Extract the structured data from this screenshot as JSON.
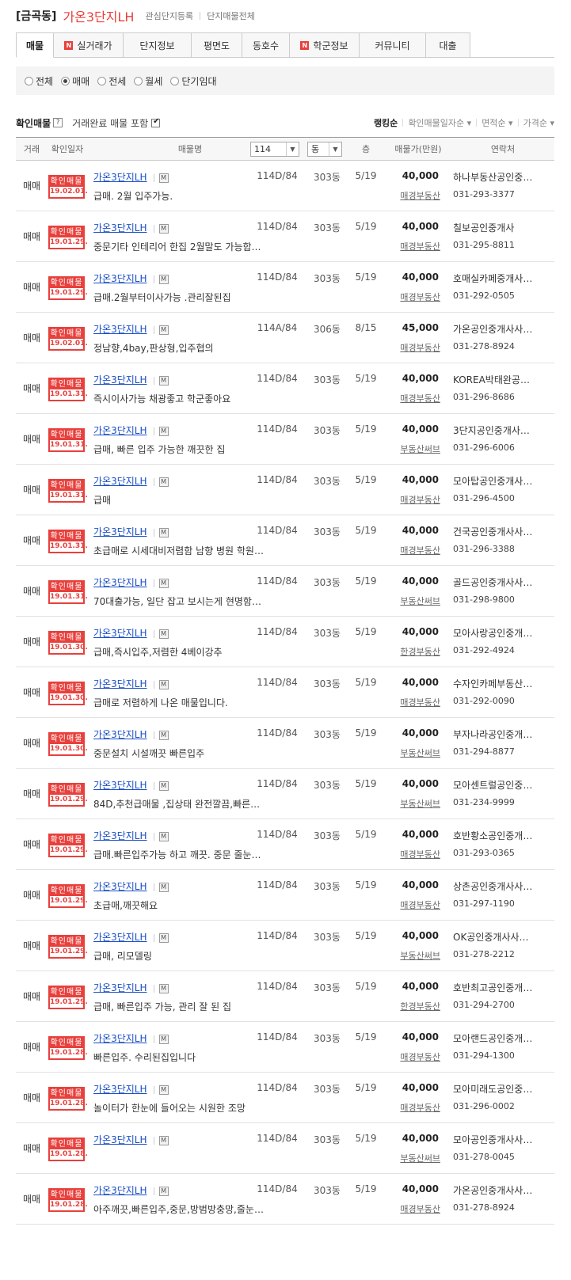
{
  "header": {
    "region": "[금곡동]",
    "complex_name": "가온3단지LH",
    "link_watch": "관심단지등록",
    "link_all": "단지매물전체"
  },
  "tabs": [
    {
      "label": "매물",
      "badge": "",
      "active": true
    },
    {
      "label": "실거래가",
      "badge": "N",
      "active": false
    },
    {
      "label": "단지정보",
      "badge": "",
      "active": false
    },
    {
      "label": "평면도",
      "badge": "",
      "active": false
    },
    {
      "label": "동호수",
      "badge": "",
      "active": false
    },
    {
      "label": "학군정보",
      "badge": "N",
      "active": false
    },
    {
      "label": "커뮤니티",
      "badge": "",
      "active": false
    },
    {
      "label": "대출",
      "badge": "",
      "active": false
    }
  ],
  "trade_types": [
    {
      "label": "전체",
      "selected": false
    },
    {
      "label": "매매",
      "selected": true
    },
    {
      "label": "전세",
      "selected": false
    },
    {
      "label": "월세",
      "selected": false
    },
    {
      "label": "단기임대",
      "selected": false
    }
  ],
  "listing_header": {
    "confirmed_label": "확인매물",
    "help_icon": "?",
    "include_completed": "거래완료 매물 포함",
    "include_completed_checked": true,
    "sorts": [
      "랭킹순",
      "확인매물일자순",
      "면적순",
      "가격순"
    ],
    "active_sort": "랭킹순"
  },
  "columns": {
    "type": "거래",
    "confirm_date": "확인일자",
    "name": "매물명",
    "area_select": "114",
    "dong_select": "동",
    "floor": "층",
    "price": "매물가(만원)",
    "contact": "연락처"
  },
  "stamp_label": "확인매물",
  "listings": [
    {
      "type": "매매",
      "date": "19.02.01.",
      "name": "가온3단지LH",
      "desc": "급매. 2월 입주가능.",
      "area": "114D/84",
      "dong": "303동",
      "floor": "5/19",
      "price": "40,000",
      "agency": "매경부동산",
      "contact": "하나부동산공인중…",
      "phone": "031-293-3377"
    },
    {
      "type": "매매",
      "date": "19.01.29.",
      "name": "가온3단지LH",
      "desc": "중문기타 인테리어 한집 2월말도 가능합…",
      "area": "114D/84",
      "dong": "303동",
      "floor": "5/19",
      "price": "40,000",
      "agency": "매경부동산",
      "contact": "칠보공인중개사",
      "phone": "031-295-8811"
    },
    {
      "type": "매매",
      "date": "19.01.29.",
      "name": "가온3단지LH",
      "desc": "급매.2월부터이사가능 .관리잘된집",
      "area": "114D/84",
      "dong": "303동",
      "floor": "5/19",
      "price": "40,000",
      "agency": "매경부동산",
      "contact": "호매실카페중개사…",
      "phone": "031-292-0505"
    },
    {
      "type": "매매",
      "date": "19.02.01.",
      "name": "가온3단지LH",
      "desc": "정남향,4bay,판상형,입주협의",
      "area": "114A/84",
      "dong": "306동",
      "floor": "8/15",
      "price": "45,000",
      "agency": "매경부동산",
      "contact": "가온공인중개사사…",
      "phone": "031-278-8924"
    },
    {
      "type": "매매",
      "date": "19.01.31.",
      "name": "가온3단지LH",
      "desc": "즉시이사가능 채광좋고 학군좋아요",
      "area": "114D/84",
      "dong": "303동",
      "floor": "5/19",
      "price": "40,000",
      "agency": "매경부동산",
      "contact": "KOREA박태완공…",
      "phone": "031-296-8686"
    },
    {
      "type": "매매",
      "date": "19.01.31.",
      "name": "가온3단지LH",
      "desc": "급매, 빠른 입주 가능한 깨끗한 집",
      "area": "114D/84",
      "dong": "303동",
      "floor": "5/19",
      "price": "40,000",
      "agency": "부동산써브",
      "contact": "3단지공인중개사…",
      "phone": "031-296-6006"
    },
    {
      "type": "매매",
      "date": "19.01.31.",
      "name": "가온3단지LH",
      "desc": "급매",
      "area": "114D/84",
      "dong": "303동",
      "floor": "5/19",
      "price": "40,000",
      "agency": "매경부동산",
      "contact": "모아탑공인중개사…",
      "phone": "031-296-4500"
    },
    {
      "type": "매매",
      "date": "19.01.31.",
      "name": "가온3단지LH",
      "desc": "초급매로 시세대비저렴함 남향 병원 학원…",
      "area": "114D/84",
      "dong": "303동",
      "floor": "5/19",
      "price": "40,000",
      "agency": "매경부동산",
      "contact": "건국공인중개사사…",
      "phone": "031-296-3388"
    },
    {
      "type": "매매",
      "date": "19.01.31.",
      "name": "가온3단지LH",
      "desc": "70대출가능, 일단 잡고 보시는게 현명함…",
      "area": "114D/84",
      "dong": "303동",
      "floor": "5/19",
      "price": "40,000",
      "agency": "부동산써브",
      "contact": "골드공인중개사사…",
      "phone": "031-298-9800"
    },
    {
      "type": "매매",
      "date": "19.01.30.",
      "name": "가온3단지LH",
      "desc": "급매,즉시입주,저렴한 4베이강추",
      "area": "114D/84",
      "dong": "303동",
      "floor": "5/19",
      "price": "40,000",
      "agency": "한경부동산",
      "contact": "모아사랑공인중개…",
      "phone": "031-292-4924"
    },
    {
      "type": "매매",
      "date": "19.01.30.",
      "name": "가온3단지LH",
      "desc": "급매로 저렴하게 나온 매물입니다.",
      "area": "114D/84",
      "dong": "303동",
      "floor": "5/19",
      "price": "40,000",
      "agency": "매경부동산",
      "contact": "수자인카페부동산…",
      "phone": "031-292-0090"
    },
    {
      "type": "매매",
      "date": "19.01.30.",
      "name": "가온3단지LH",
      "desc": "중문설치 시설깨끗 빠른입주",
      "area": "114D/84",
      "dong": "303동",
      "floor": "5/19",
      "price": "40,000",
      "agency": "부동산써브",
      "contact": "부자나라공인중개…",
      "phone": "031-294-8877"
    },
    {
      "type": "매매",
      "date": "19.01.29.",
      "name": "가온3단지LH",
      "desc": "84D,추천급매물 ,집상태 완전깔끔,빠른…",
      "area": "114D/84",
      "dong": "303동",
      "floor": "5/19",
      "price": "40,000",
      "agency": "부동산써브",
      "contact": "모아센트럴공인중…",
      "phone": "031-234-9999"
    },
    {
      "type": "매매",
      "date": "19.01.29.",
      "name": "가온3단지LH",
      "desc": "급매.빠른입주가능 하고 깨끗. 중문 줄눈…",
      "area": "114D/84",
      "dong": "303동",
      "floor": "5/19",
      "price": "40,000",
      "agency": "매경부동산",
      "contact": "호반황소공인중개…",
      "phone": "031-293-0365"
    },
    {
      "type": "매매",
      "date": "19.01.29.",
      "name": "가온3단지LH",
      "desc": "초급매,깨끗해요",
      "area": "114D/84",
      "dong": "303동",
      "floor": "5/19",
      "price": "40,000",
      "agency": "매경부동산",
      "contact": "상촌공인중개사사…",
      "phone": "031-297-1190"
    },
    {
      "type": "매매",
      "date": "19.01.29.",
      "name": "가온3단지LH",
      "desc": "급매, 리모델링",
      "area": "114D/84",
      "dong": "303동",
      "floor": "5/19",
      "price": "40,000",
      "agency": "부동산써브",
      "contact": "OK공인중개사사…",
      "phone": "031-278-2212"
    },
    {
      "type": "매매",
      "date": "19.01.29.",
      "name": "가온3단지LH",
      "desc": "급매, 빠른입주 가능, 관리 잘 된 집",
      "area": "114D/84",
      "dong": "303동",
      "floor": "5/19",
      "price": "40,000",
      "agency": "한경부동산",
      "contact": "호반최고공인중개…",
      "phone": "031-294-2700"
    },
    {
      "type": "매매",
      "date": "19.01.28.",
      "name": "가온3단지LH",
      "desc": "빠른입주. 수리된집입니다",
      "area": "114D/84",
      "dong": "303동",
      "floor": "5/19",
      "price": "40,000",
      "agency": "매경부동산",
      "contact": "모아랜드공인중개…",
      "phone": "031-294-1300"
    },
    {
      "type": "매매",
      "date": "19.01.28.",
      "name": "가온3단지LH",
      "desc": "놀이터가 한눈에 들어오는 시원한 조망",
      "area": "114D/84",
      "dong": "303동",
      "floor": "5/19",
      "price": "40,000",
      "agency": "매경부동산",
      "contact": "모아미래도공인중…",
      "phone": "031-296-0002"
    },
    {
      "type": "매매",
      "date": "19.01.28.",
      "name": "가온3단지LH",
      "desc": "",
      "area": "114D/84",
      "dong": "303동",
      "floor": "5/19",
      "price": "40,000",
      "agency": "부동산써브",
      "contact": "모아공인중개사사…",
      "phone": "031-278-0045"
    },
    {
      "type": "매매",
      "date": "19.01.28.",
      "name": "가온3단지LH",
      "desc": "아주깨끗,빠른입주,중문,방범방충망,줄눈…",
      "area": "114D/84",
      "dong": "303동",
      "floor": "5/19",
      "price": "40,000",
      "agency": "매경부동산",
      "contact": "가온공인중개사사…",
      "phone": "031-278-8924"
    }
  ]
}
